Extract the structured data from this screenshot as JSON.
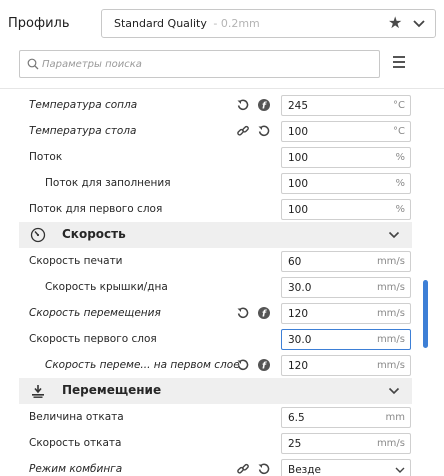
{
  "profile": {
    "label": "Профиль",
    "value": "Standard Quality",
    "sub": " - 0.2mm"
  },
  "search": {
    "placeholder": "Параметры поиска"
  },
  "rows": [
    {
      "label": "Температура сопла",
      "value": "245",
      "unit": "°C",
      "italic": true
    },
    {
      "label": "Температура стола",
      "value": "100",
      "unit": "°C",
      "italic": true
    },
    {
      "label": "Поток",
      "value": "100",
      "unit": "%"
    },
    {
      "label": "Поток для заполнения",
      "value": "100",
      "unit": "%"
    },
    {
      "label": "Поток для первого слоя",
      "value": "100",
      "unit": "%"
    },
    {
      "label": "Скорость печати",
      "value": "60",
      "unit": "mm/s"
    },
    {
      "label": "Скорость крышки/дна",
      "value": "30.0",
      "unit": "mm/s"
    },
    {
      "label": "Скорость перемещения",
      "value": "120",
      "unit": "mm/s",
      "italic": true
    },
    {
      "label": "Скорость первого слоя",
      "value": "30.0",
      "unit": "mm/s",
      "focused": true
    },
    {
      "label": "Скорость переме... на первом слое",
      "value": "120",
      "unit": "mm/s",
      "italic": true
    },
    {
      "label": "Величина отката",
      "value": "6.5",
      "unit": "mm"
    },
    {
      "label": "Скорость отката",
      "value": "25",
      "unit": "mm/s"
    },
    {
      "label": "Режим комбинга",
      "value": "Везде",
      "italic": true
    }
  ],
  "sections": {
    "speed": "Скорость",
    "travel": "Перемещение"
  },
  "icons": {
    "reset": "reset-icon",
    "info": "info-icon",
    "link": "link-icon"
  },
  "colors": {
    "accent": "#3d7fd6",
    "section_bg": "#efefef"
  }
}
